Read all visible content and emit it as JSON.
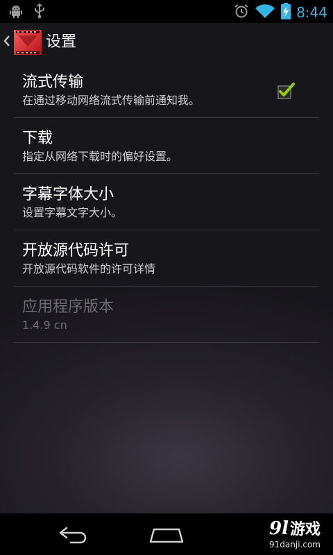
{
  "status_bar": {
    "time": "8:44",
    "icons": [
      "android-debug-icon",
      "usb-icon",
      "alarm-icon",
      "wifi-icon",
      "battery-charging-icon"
    ]
  },
  "action_bar": {
    "title": "设置",
    "icons": [
      "up-caret-icon",
      "app-movie-icon"
    ]
  },
  "preferences": [
    {
      "title": "流式传输",
      "summary": "在通过移动网络流式传输前通知我。",
      "has_checkbox": true,
      "checked": true,
      "enabled": true
    },
    {
      "title": "下载",
      "summary": "指定从网络下载时的偏好设置。",
      "has_checkbox": false,
      "enabled": true
    },
    {
      "title": "字幕字体大小",
      "summary": "设置字幕文字大小。",
      "has_checkbox": false,
      "enabled": true
    },
    {
      "title": "开放源代码许可",
      "summary": "开放源代码软件的许可详情",
      "has_checkbox": false,
      "enabled": true
    },
    {
      "title": "应用程序版本",
      "summary": "1.4.9 cn",
      "has_checkbox": false,
      "enabled": false
    }
  ],
  "nav_bar": {
    "icons": [
      "back-icon",
      "home-icon"
    ],
    "watermark": {
      "logo_number": "9l",
      "logo_name": "游戏",
      "url": "91danji.com"
    }
  },
  "colors": {
    "accent": "#33b5e5",
    "check_green": "#99cc00",
    "background": "#1f1d23",
    "divider": "#3b3b3f"
  }
}
